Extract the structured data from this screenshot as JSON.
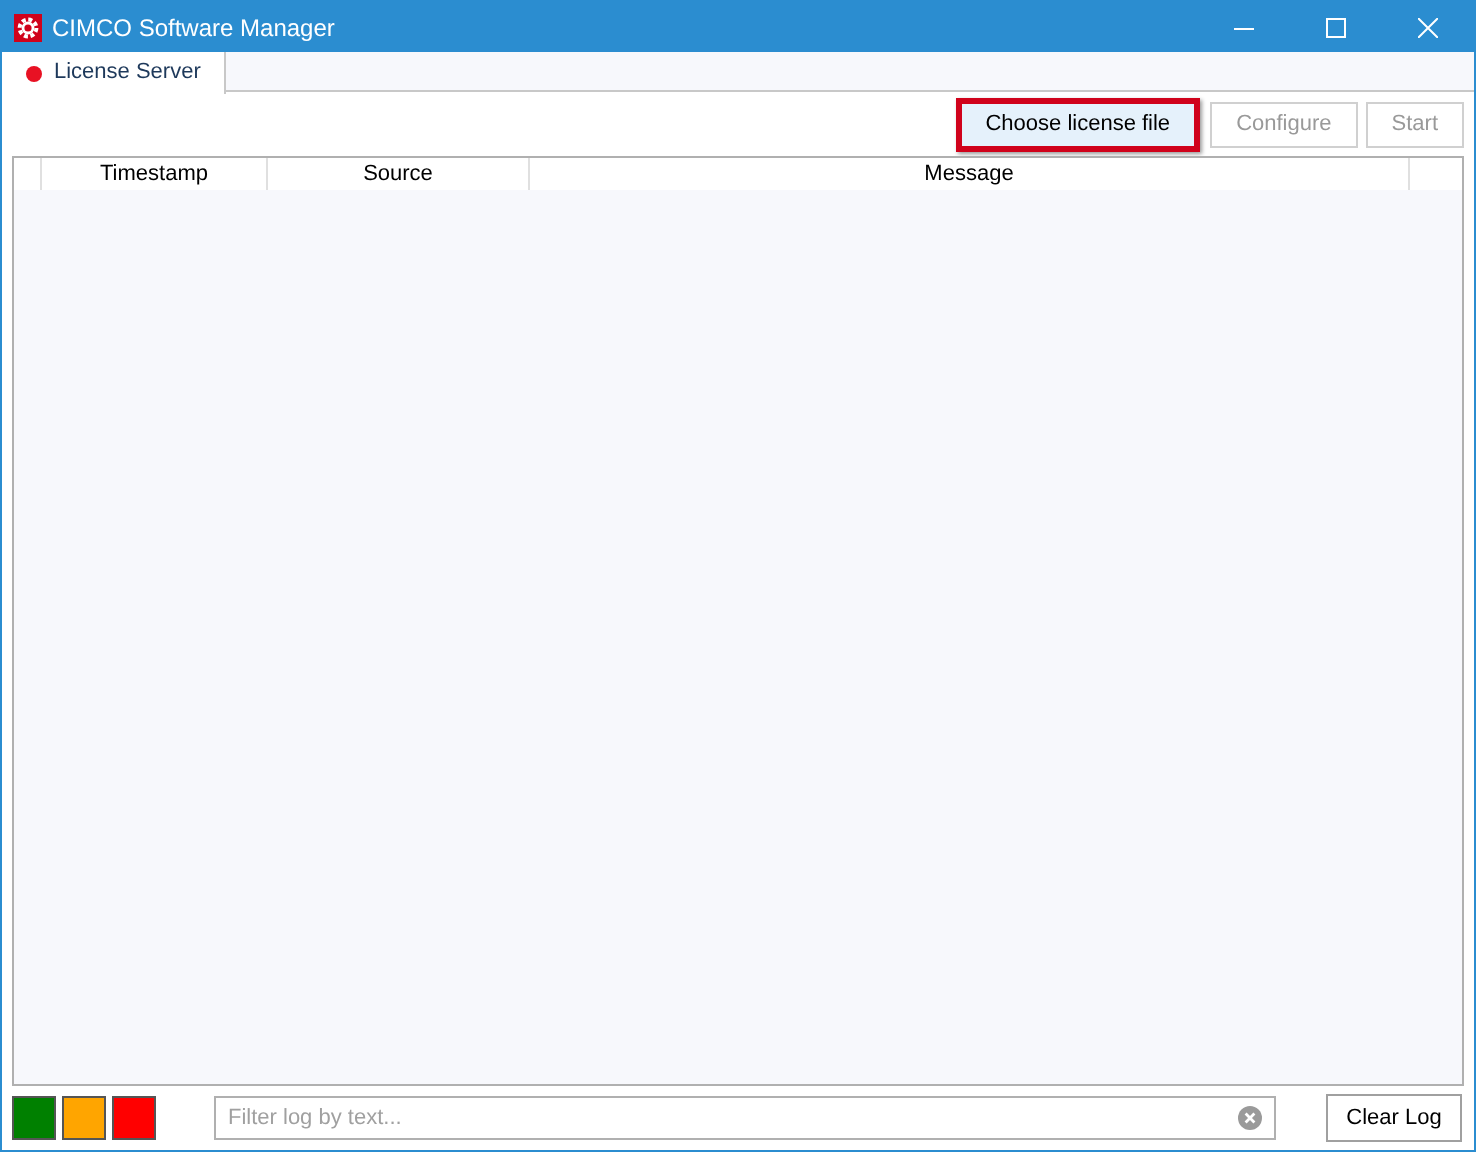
{
  "window": {
    "title": "CIMCO Software Manager"
  },
  "tabs": [
    {
      "label": "License Server",
      "selected": true,
      "color": "#e81123"
    }
  ],
  "toolbar": [
    {
      "label": "Choose license file",
      "disabled": false,
      "highlighted": true
    },
    {
      "label": "Configure",
      "disabled": true,
      "highlighted": false
    },
    {
      "label": "Start",
      "disabled": true,
      "highlighted": false
    }
  ],
  "table": {
    "columns": [
      "Timestamp",
      "Source",
      "Message"
    ]
  },
  "filters": [
    {
      "color": "#008000"
    },
    {
      "color": "#ffa500"
    },
    {
      "color": "#ff0000"
    }
  ],
  "search": {
    "placeholder": "Filter log by text..."
  },
  "buttons": [
    "Clear Log"
  ]
}
